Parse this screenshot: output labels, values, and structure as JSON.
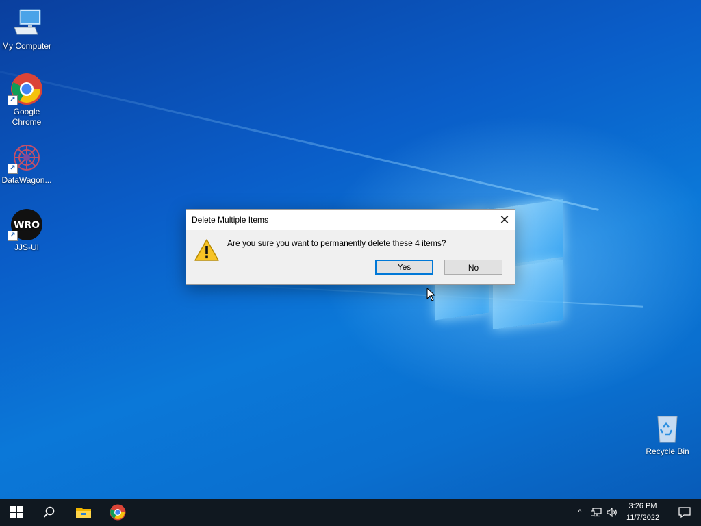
{
  "desktop": {
    "icons": [
      {
        "label": "My Computer",
        "icon": "computer-icon"
      },
      {
        "label": "Google Chrome",
        "icon": "chrome-icon"
      },
      {
        "label": "DataWagon...",
        "icon": "datawagon-icon"
      },
      {
        "label": "JJS-UI",
        "icon": "jjs-ui-icon",
        "logo_text": "WRO"
      },
      {
        "label": "Recycle Bin",
        "icon": "recycle-bin-icon"
      }
    ]
  },
  "dialog": {
    "title": "Delete Multiple Items",
    "close_glyph": "✕",
    "message": "Are you sure you want to permanently delete these 4 items?",
    "icon": "warning-icon",
    "yes_label": "Yes",
    "no_label": "No",
    "default_button": "Yes"
  },
  "taskbar": {
    "items": [
      "start-icon",
      "search-icon",
      "file-explorer-icon",
      "chrome-icon"
    ],
    "tray": {
      "chevron": "^",
      "network_icon": "network-icon",
      "volume_icon": "volume-icon",
      "time": "3:26 PM",
      "date": "11/7/2022",
      "notification_icon": "notification-icon"
    }
  },
  "colors": {
    "accent": "#0078d7",
    "taskbar": "#101820",
    "warning": "#f7c325"
  }
}
